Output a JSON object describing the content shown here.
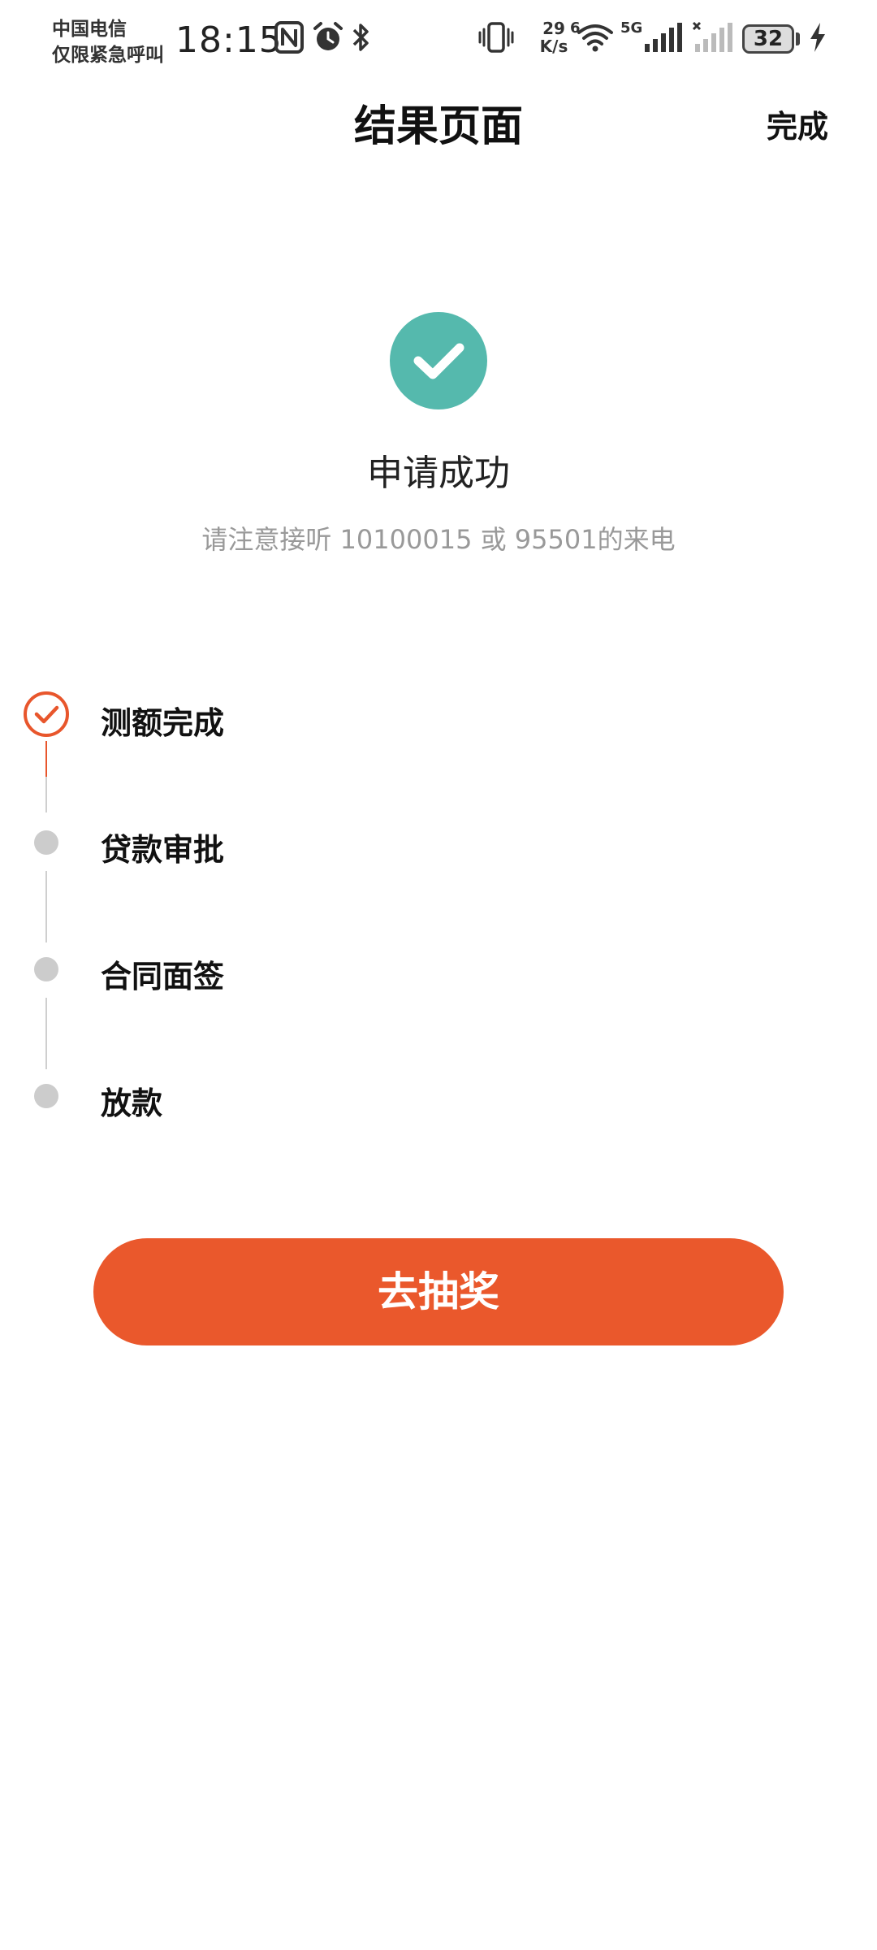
{
  "status_bar": {
    "carrier_line1": "中国电信",
    "carrier_line2": "仅限紧急呼叫",
    "time": "18:15",
    "net_speed_value": "29",
    "net_speed_unit": "K/s",
    "wifi_label": "6",
    "cellular_label": "5G",
    "battery_level": "32",
    "icons": [
      "nfc-icon",
      "alarm-icon",
      "bluetooth-icon",
      "vibrate-icon",
      "wifi-icon",
      "signal-icon",
      "signal-off-icon",
      "battery-icon",
      "charging-icon"
    ]
  },
  "nav": {
    "title": "结果页面",
    "done_label": "完成"
  },
  "result": {
    "icon": "check-icon",
    "title": "申请成功",
    "subtitle": "请注意接听 10100015 或 95501的来电"
  },
  "steps": [
    {
      "label": "测额完成",
      "status": "done"
    },
    {
      "label": "贷款审批",
      "status": "pending"
    },
    {
      "label": "合同面签",
      "status": "pending"
    },
    {
      "label": "放款",
      "status": "pending"
    }
  ],
  "action": {
    "label": "去抽奖"
  },
  "colors": {
    "success": "#55b9ad",
    "accent": "#ea582c",
    "pending": "#cccccc",
    "subtitle": "#999999"
  }
}
